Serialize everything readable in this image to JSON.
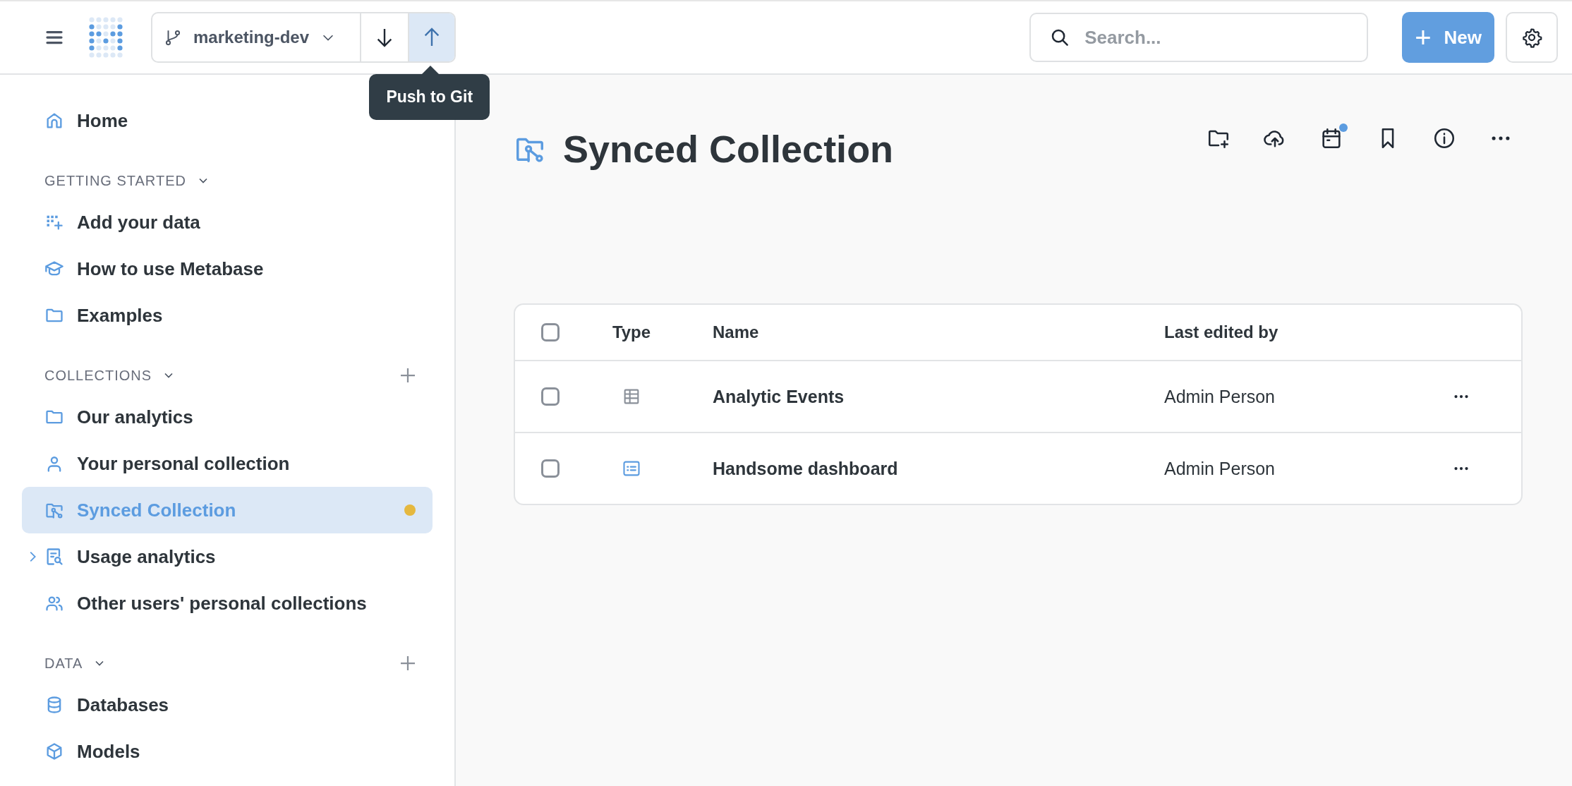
{
  "topbar": {
    "branch": "marketing-dev",
    "pull_selected": false,
    "push_selected": true,
    "tooltip": "Push to Git",
    "search": {
      "placeholder": "Search..."
    },
    "new_button": {
      "icon": "+",
      "label": "New"
    }
  },
  "sidebar": {
    "items": [
      {
        "label": "Home",
        "selected": false
      }
    ],
    "sections": [
      {
        "title": "GETTING STARTED",
        "expanded": true,
        "can_add": false,
        "items": [
          {
            "label": "Add your data",
            "selected": false
          },
          {
            "label": "How to use Metabase",
            "selected": false
          },
          {
            "label": "Examples",
            "selected": false
          }
        ]
      },
      {
        "title": "COLLECTIONS",
        "expanded": true,
        "can_add": true,
        "items": [
          {
            "label": "Our analytics",
            "selected": false
          },
          {
            "label": "Your personal collection",
            "selected": false
          },
          {
            "label": "Synced Collection",
            "selected": true,
            "changed": true
          },
          {
            "label": "Usage analytics",
            "selected": false,
            "expanded": false
          },
          {
            "label": "Other users' personal collections",
            "selected": false
          }
        ]
      },
      {
        "title": "DATA",
        "expanded": true,
        "can_add": true,
        "items": [
          {
            "label": "Databases",
            "selected": false
          },
          {
            "label": "Models",
            "selected": false
          }
        ]
      }
    ]
  },
  "main": {
    "title": "Synced Collection",
    "schedule_notice": true,
    "table": {
      "columns": [
        "Type",
        "Name",
        "Last edited by"
      ],
      "all_checked": false,
      "rows": [
        {
          "kind": "table",
          "name": "Analytic Events",
          "last_edited_by": "Admin Person",
          "checked": false
        },
        {
          "kind": "dashboard",
          "name": "Handsome dashboard",
          "last_edited_by": "Admin Person",
          "checked": false
        }
      ]
    }
  }
}
